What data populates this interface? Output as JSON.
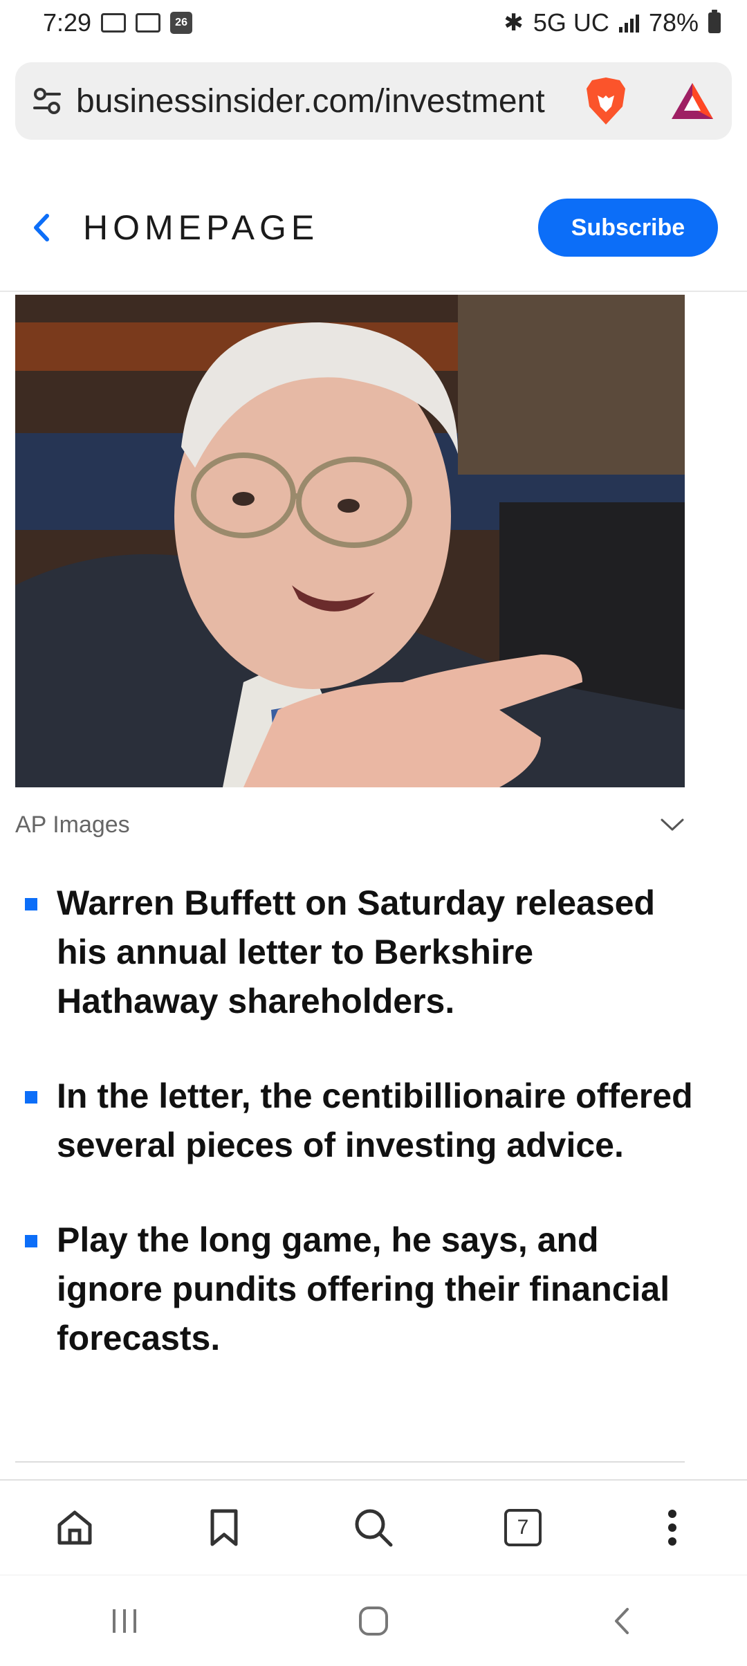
{
  "status_bar": {
    "time": "7:29",
    "calendar_day": "26",
    "network": "5G UC",
    "battery": "78%"
  },
  "browser": {
    "url": "businessinsider.com/investment"
  },
  "article_header": {
    "back_label": "HOMEPAGE",
    "subscribe_label": "Subscribe"
  },
  "hero": {
    "caption": "AP Images"
  },
  "bullets": [
    "Warren Buffett on Saturday released his annual letter to Berkshire Hathaway shareholders.",
    "In the letter, the centibillionaire offered several pieces of investing advice.",
    "Play the long game, he says, and ignore pundits offering their financial forecasts."
  ],
  "toolbar": {
    "tab_count": "7",
    "icons": [
      "home-icon",
      "bookmark-icon",
      "search-icon",
      "tabs-icon",
      "more-vert-icon"
    ]
  },
  "colors": {
    "accent": "#0c6ef8",
    "brave_orange": "#fb542b"
  }
}
